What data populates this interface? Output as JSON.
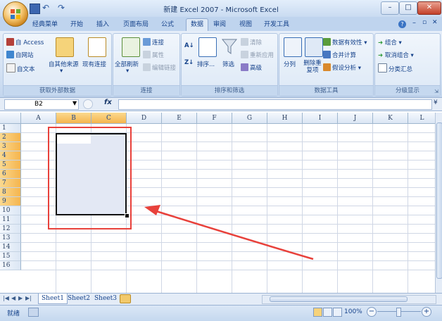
{
  "window": {
    "title": "新建 Excel 2007 - Microsoft Excel"
  },
  "quick_access": {
    "undo": "↶",
    "redo": "↷"
  },
  "tabs": [
    "经典菜单",
    "开始",
    "插入",
    "页面布局",
    "公式",
    "数据",
    "审阅",
    "视图",
    "开发工具"
  ],
  "active_tab": "数据",
  "ribbon": {
    "groups": {
      "get_external": {
        "title": "获取外部数据",
        "access": "自 Access",
        "web": "自网站",
        "text": "自文本",
        "other_sources": "自其他来源",
        "existing": "现有连接"
      },
      "connections": {
        "title": "连接",
        "refresh_all": "全部刷新",
        "connections": "连接",
        "properties": "属性",
        "edit_links": "编辑链接"
      },
      "sort_filter": {
        "title": "排序和筛选",
        "sort": "排序...",
        "filter": "筛选",
        "clear": "清除",
        "reapply": "重新应用",
        "advanced": "高级"
      },
      "data_tools": {
        "title": "数据工具",
        "text_to_columns": "分列",
        "remove_duplicates": "删除重复项",
        "validation": "数据有效性",
        "consolidate": "合并计算",
        "what_if": "假设分析"
      },
      "outline": {
        "title": "分级显示",
        "group": "组合",
        "ungroup": "取消组合",
        "subtotal": "分类汇总"
      }
    }
  },
  "formula_bar": {
    "name_box": "B2",
    "fx": "fx",
    "formula": ""
  },
  "columns": [
    "A",
    "B",
    "C",
    "D",
    "E",
    "F",
    "G",
    "H",
    "I",
    "J",
    "K",
    "L"
  ],
  "selected_columns": [
    "B",
    "C"
  ],
  "rows": [
    "1",
    "2",
    "3",
    "4",
    "5",
    "6",
    "7",
    "8",
    "9",
    "10",
    "11",
    "12",
    "13",
    "14",
    "15",
    "16"
  ],
  "selected_rows": [
    "2",
    "3",
    "4",
    "5",
    "6",
    "7",
    "8",
    "9"
  ],
  "sheets": [
    "Sheet1",
    "Sheet2",
    "Sheet3"
  ],
  "active_sheet": "Sheet1",
  "status": {
    "ready": "就绪",
    "zoom": "100%"
  },
  "colors": {
    "accent": "#15428b",
    "annotation": "#e8413b",
    "selection": "#e3e8f4"
  }
}
